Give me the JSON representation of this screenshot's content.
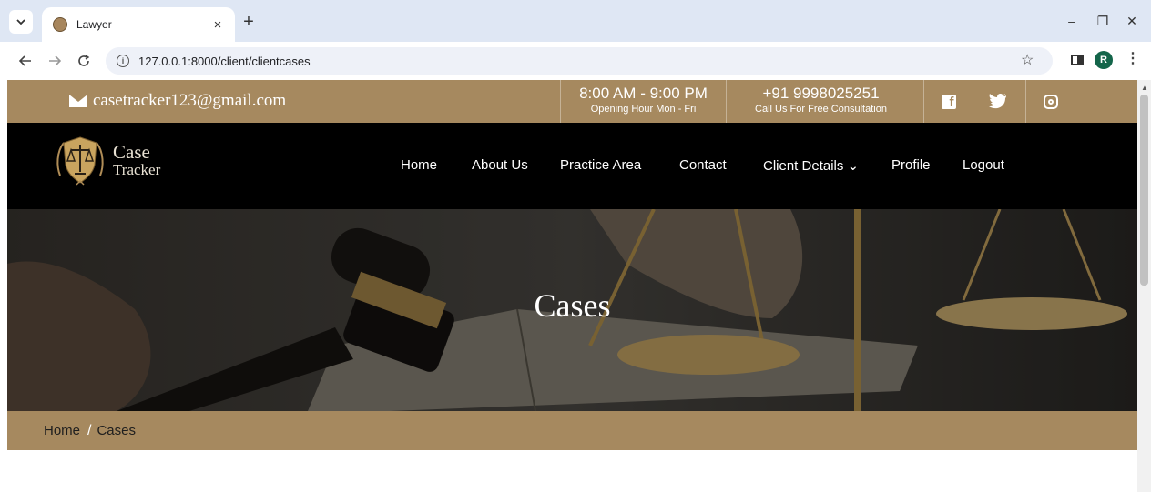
{
  "browser": {
    "tab_title": "Lawyer",
    "tab_close": "×",
    "new_tab": "+",
    "url": "127.0.0.1:8000/client/clientcases",
    "profile_initial": "R",
    "window_controls": {
      "minimize": "–",
      "restore": "❐",
      "close": "✕"
    }
  },
  "topbar": {
    "email": "casetracker123@gmail.com",
    "hours": {
      "main": "8:00 AM - 9:00 PM",
      "sub": "Opening Hour Mon - Fri"
    },
    "phone": {
      "main": "+91 9998025251",
      "sub": "Call Us For Free Consultation"
    },
    "social_icons": [
      "facebook-icon",
      "twitter-icon",
      "instagram-icon"
    ]
  },
  "logo": {
    "line1": "Case",
    "line2": "Tracker"
  },
  "nav": {
    "items": [
      "Home",
      "About Us",
      "Practice Area",
      "Contact",
      "Client Details",
      "Profile",
      "Logout"
    ],
    "dropdown_marker": "⌄"
  },
  "hero": {
    "title": "Cases"
  },
  "breadcrumb": {
    "home": "Home",
    "separator": "/",
    "current": "Cases"
  },
  "colors": {
    "brand_gold": "#a6895f",
    "nav_bg": "#000000",
    "chrome_bg": "#dfe7f4"
  }
}
